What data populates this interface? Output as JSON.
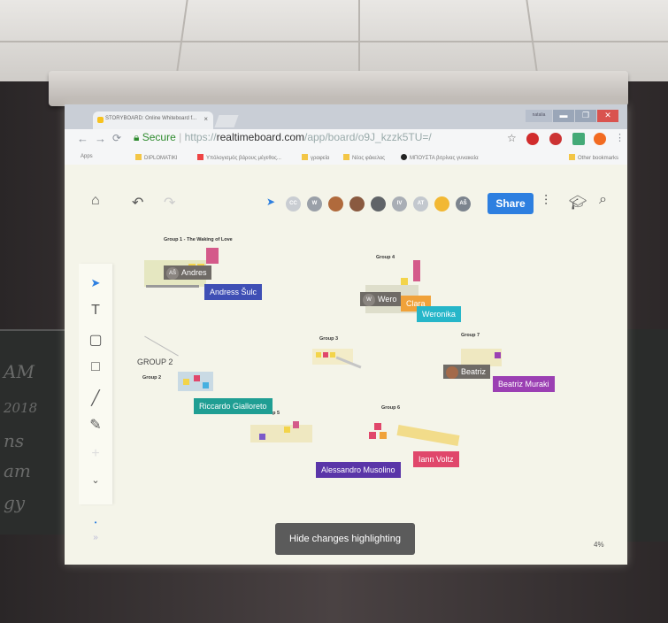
{
  "browser": {
    "tab_title": "STORYBOARD: Online Whiteboard f...",
    "tab_close": "×",
    "user_chip": "natalia",
    "url_secure": "Secure",
    "url_prefix": "https://",
    "url_host": "realtimeboard.com",
    "url_path": "/app/board/o9J_kzzk5TU=/",
    "bookmarks": [
      {
        "label": "Apps"
      },
      {
        "label": "DIPLOMATIKI"
      },
      {
        "label": "Υπόλογισμός βάρους μέγεθος..."
      },
      {
        "label": "γραφεία"
      },
      {
        "label": "Νέος φάκελος"
      },
      {
        "label": "ΜΠΟΥΣΤΑ βιτρίνας γυναικεία"
      },
      {
        "label": "Other bookmarks"
      }
    ]
  },
  "toolbar": {
    "share_label": "Share",
    "avatars": [
      {
        "initials": "CC",
        "color": "#c9cdd2"
      },
      {
        "initials": "W",
        "color": "#9aa0a8"
      },
      {
        "initials": "",
        "color": "#b06a3c"
      },
      {
        "initials": "",
        "color": "#8a5a40"
      },
      {
        "initials": "",
        "color": "#606468"
      },
      {
        "initials": "IV",
        "color": "#a9aeb5"
      },
      {
        "initials": "AT",
        "color": "#c3c8ce"
      },
      {
        "initials": "",
        "color": "#f2b833"
      },
      {
        "initials": "AŠ",
        "color": "#7c848e"
      }
    ]
  },
  "board": {
    "groups": [
      {
        "id": "g1",
        "title": "Group 1 - The Waking of Love"
      },
      {
        "id": "g2",
        "title": "Group 2"
      },
      {
        "id": "g2b",
        "title": "GROUP 2"
      },
      {
        "id": "g3",
        "title": "Group 3"
      },
      {
        "id": "g4",
        "title": "Group 4"
      },
      {
        "id": "g5",
        "title": "Group 5"
      },
      {
        "id": "g6",
        "title": "Group 6"
      },
      {
        "id": "g7",
        "title": "Group 7"
      }
    ],
    "cursors": [
      {
        "name": "Andress Šulc",
        "short": "Andres",
        "chip": "AŠ",
        "color": "#3f4fb5"
      },
      {
        "name": "Weronika",
        "short": "Wero",
        "chip": "W",
        "color": "#26b6c9"
      },
      {
        "name": "Clara",
        "short": "Clara",
        "chip": "",
        "color": "#f0a23a"
      },
      {
        "name": "Beatriz Muraki",
        "short": "Beatriz",
        "chip": "",
        "color": "#9b3fb3"
      },
      {
        "name": "Riccardo Gialloreto",
        "short": "",
        "chip": "",
        "color": "#1f9e93"
      },
      {
        "name": "Alessandro Musolino",
        "short": "",
        "chip": "",
        "color": "#5a35a8"
      },
      {
        "name": "Iann Voltz",
        "short": "",
        "chip": "",
        "color": "#e0476b"
      }
    ]
  },
  "footer": {
    "hide_changes_label": "Hide changes highlighting",
    "zoom_label": "4%"
  },
  "chalk": [
    "AM",
    "2018",
    "ns",
    "am",
    "gy"
  ]
}
